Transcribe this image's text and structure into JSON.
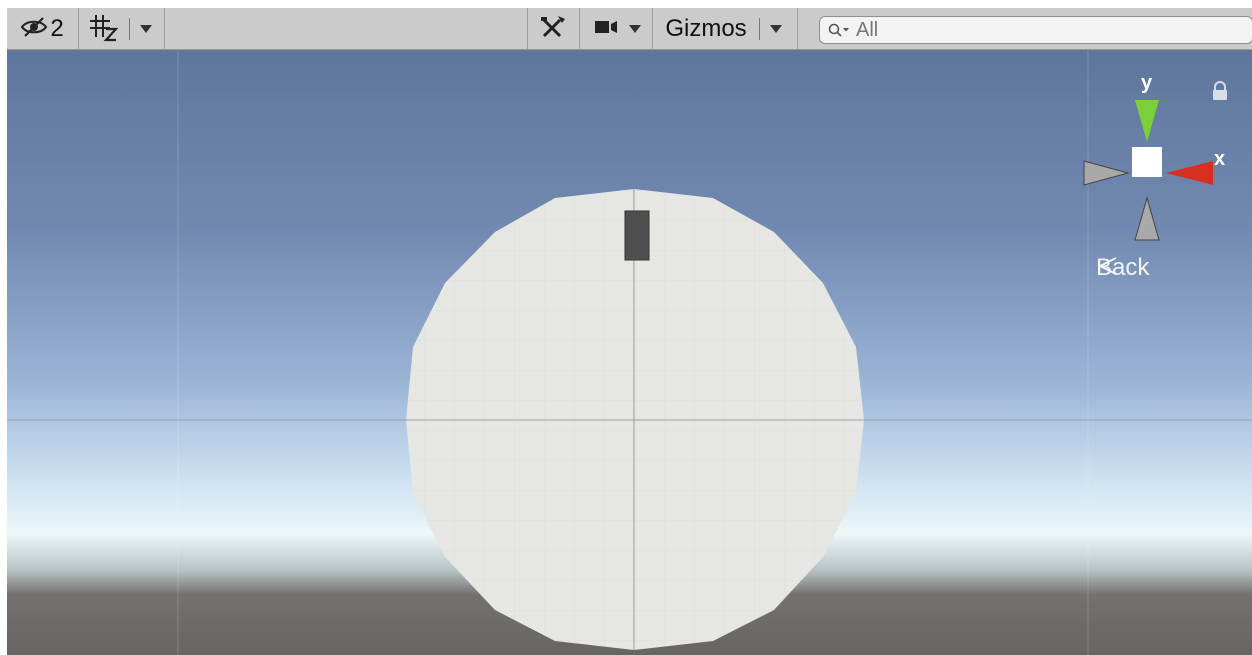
{
  "toolbar": {
    "hidden_count": "2",
    "gizmos_label": "Gizmos",
    "search_placeholder": "All",
    "icons": {
      "visibility": "eye-slash-icon",
      "grid": "grid-snap-icon",
      "tools": "tools-icon",
      "camera": "camera-icon",
      "search": "search-icon"
    }
  },
  "orientation_gizmo": {
    "y_label": "y",
    "x_label": "x",
    "view_label": "Back",
    "colors": {
      "y_axis": "#7bd03a",
      "x_axis": "#d8301f",
      "neutral": "#a9a9a9"
    }
  },
  "scene": {
    "sky_top": "#5e759c",
    "horizon": "#ecf7f8",
    "ground": "#6a6665",
    "disc": "#e6e6e3",
    "object": "#4f4f4f"
  }
}
